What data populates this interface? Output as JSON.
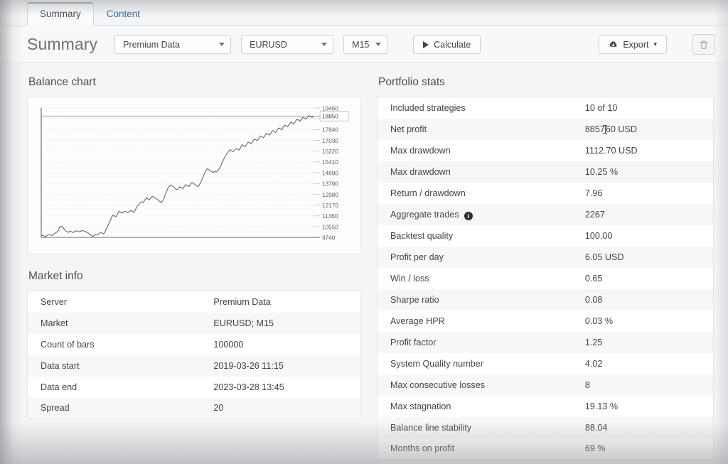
{
  "tabs": [
    {
      "label": "Summary",
      "active": true
    },
    {
      "label": "Content",
      "active": false
    }
  ],
  "toolbar": {
    "page_title": "Summary",
    "server_select": "Premium Data",
    "symbol_select": "EURUSD",
    "timeframe_select": "M15",
    "calculate_label": "Calculate",
    "export_label": "Export",
    "export_caret": "▾",
    "delete_icon": "trash-icon",
    "play_icon": "play-icon",
    "cloud_icon": "cloud-download-icon"
  },
  "balance_chart": {
    "title": "Balance chart"
  },
  "chart_data": {
    "type": "line",
    "title": "Balance chart",
    "xlabel": "",
    "ylabel": "",
    "grid": true,
    "legend": false,
    "ylim": [
      9740,
      19460
    ],
    "ytick_step": 810,
    "yticks": [
      9740,
      10550,
      11360,
      12170,
      12980,
      13790,
      14600,
      15410,
      16220,
      17030,
      17840,
      18650,
      19460
    ],
    "ytick_labels": [
      "9740",
      "10550",
      "11360",
      "12170",
      "12980",
      "13790",
      "14600",
      "15410",
      "16220",
      "17030",
      "17840",
      "18850",
      "19460"
    ],
    "current_value_label": "18850",
    "current_value": 18850,
    "line_color": "#6f6a70",
    "series": [
      {
        "name": "Balance",
        "values": [
          9860,
          9900,
          9840,
          9800,
          9900,
          9960,
          9920,
          9880,
          9950,
          10050,
          10120,
          10200,
          10480,
          10580,
          10520,
          10380,
          10240,
          10180,
          10120,
          10220,
          10160,
          10100,
          10180,
          10240,
          10200,
          10160,
          10210,
          10260,
          10230,
          10180,
          10120,
          10060,
          9960,
          9880,
          9820,
          9900,
          9980,
          9940,
          10020,
          10120,
          10060,
          10000,
          10180,
          10420,
          10680,
          10920,
          11180,
          11420,
          11360,
          11280,
          11480,
          11700,
          11640,
          11560,
          11620,
          11700,
          11660,
          11600,
          11680,
          11760,
          11700,
          11620,
          11840,
          12080,
          12200,
          12320,
          12420,
          12360,
          12540,
          12700,
          12640,
          12560,
          12700,
          12840,
          12780,
          12700,
          12620,
          12540,
          12440,
          12360,
          12520,
          12800,
          13100,
          13380,
          13540,
          13680,
          13620,
          13540,
          13420,
          13320,
          13400,
          13540,
          13480,
          13400,
          13560,
          13700,
          13640,
          13560,
          13720,
          13860,
          13800,
          13720,
          13640,
          13560,
          13700,
          13920,
          14180,
          14460,
          14720,
          14900,
          14840,
          14760,
          14680,
          14620,
          14700,
          14660,
          14740,
          14900,
          15120,
          15380,
          15620,
          15840,
          16020,
          16180,
          16320,
          16260,
          16180,
          16280,
          16420,
          16380,
          16300,
          16480,
          16700,
          16640,
          16560,
          16720,
          16900,
          16840,
          16760,
          16940,
          17140,
          17080,
          17000,
          17180,
          17360,
          17300,
          17220,
          17380,
          17560,
          17500,
          17420,
          17580,
          17760,
          17700,
          17620,
          17780,
          17960,
          17900,
          17820,
          18000,
          18180,
          18120,
          18040,
          18220,
          18400,
          18340,
          18260,
          18440,
          18620,
          18560,
          18480,
          18600,
          18760,
          18700,
          18620,
          18760,
          18880,
          18820,
          18740,
          18850
        ]
      }
    ]
  },
  "market_info": {
    "title": "Market info",
    "rows": [
      {
        "key": "Server",
        "value": "Premium Data"
      },
      {
        "key": "Market",
        "value": "EURUSD; M15"
      },
      {
        "key": "Count of bars",
        "value": "100000"
      },
      {
        "key": "Data start",
        "value": "2019-03-26 11:15"
      },
      {
        "key": "Data end",
        "value": "2023-03-28 13:45"
      },
      {
        "key": "Spread",
        "value": "20"
      }
    ]
  },
  "portfolio_stats": {
    "title": "Portfolio stats",
    "rows": [
      {
        "key": "Included strategies",
        "value": "10 of 10"
      },
      {
        "key": "Net profit",
        "value": "8857.60 USD",
        "caret": true
      },
      {
        "key": "Max drawdown",
        "value": "1112.70 USD"
      },
      {
        "key": "Max drawdown",
        "value": "10.25 %"
      },
      {
        "key": "Return / drawdown",
        "value": "7.96"
      },
      {
        "key": "Aggregate trades",
        "value": "2267",
        "info": true
      },
      {
        "key": "Backtest quality",
        "value": "100.00"
      },
      {
        "key": "Profit per day",
        "value": "6.05 USD"
      },
      {
        "key": "Win / loss",
        "value": "0.65"
      },
      {
        "key": "Sharpe ratio",
        "value": "0.08"
      },
      {
        "key": "Average HPR",
        "value": "0.03 %"
      },
      {
        "key": "Profit factor",
        "value": "1.25"
      },
      {
        "key": "System Quality number",
        "value": "4.02"
      },
      {
        "key": "Max consecutive losses",
        "value": "8"
      },
      {
        "key": "Max stagnation",
        "value": "19.13 %"
      },
      {
        "key": "Balance line stability",
        "value": "88.04"
      },
      {
        "key": "Months on profit",
        "value": "69 %"
      }
    ]
  },
  "colors": {
    "page_bg": "#f4f5f7",
    "card_bg": "#ffffff",
    "row_alt": "#f6f7f8",
    "border": "#e3e5e8",
    "text": "#41464a",
    "link": "#2d6ca2",
    "chart_line": "#6f6a70",
    "grid": "#e9e4ea"
  }
}
